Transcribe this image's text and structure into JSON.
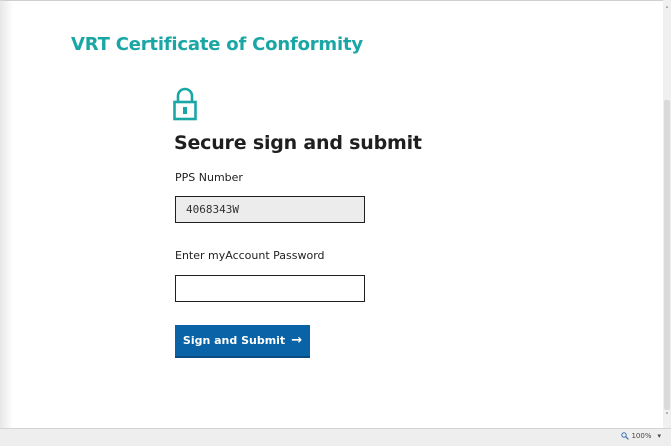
{
  "page": {
    "app_title": "VRT Certificate of Conformity",
    "heading": "Secure sign and submit"
  },
  "icons": {
    "lock": "lock-icon",
    "arrow": "arrow-right-icon",
    "zoom": "magnifier-icon"
  },
  "form": {
    "pps_label": "PPS Number",
    "pps_value": "4068343W",
    "password_label": "Enter myAccount Password",
    "password_value": "",
    "submit_label": "Sign and Submit",
    "submit_arrow": "→"
  },
  "status_bar": {
    "zoom_level": "100%",
    "zoom_caret": "▾"
  },
  "scrollbar": {
    "up_arrow": "˄",
    "down_arrow": "˅"
  },
  "colors": {
    "accent": "#1ba6a6",
    "button": "#0a63a6",
    "heading": "#1f1f1f"
  }
}
